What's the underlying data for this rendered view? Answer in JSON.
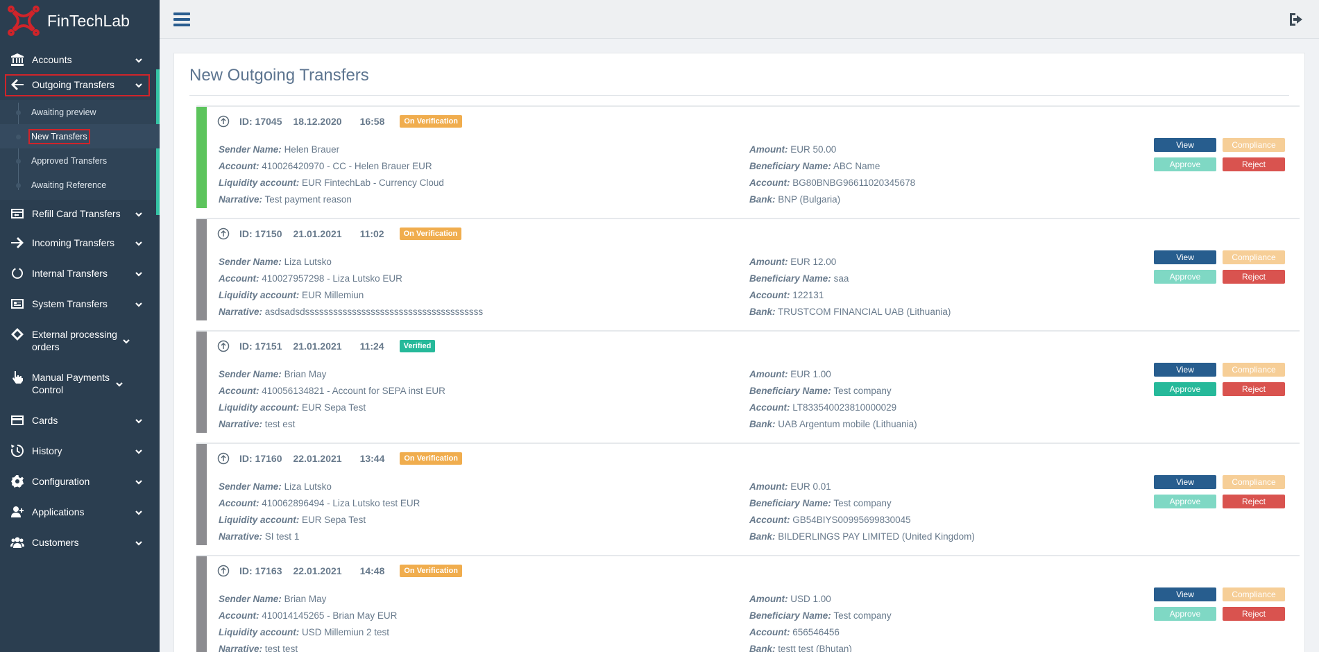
{
  "brand": {
    "name": "FinTechLab",
    "logo_color": "#d0242a"
  },
  "sidebar": {
    "items": [
      {
        "label": "Accounts",
        "icon": "bank-icon"
      },
      {
        "label": "Outgoing Transfers",
        "icon": "arrow-left-icon"
      },
      {
        "label": "Refill Card Transfers",
        "icon": "card-refill-icon"
      },
      {
        "label": "Incoming Transfers",
        "icon": "arrow-right-icon"
      },
      {
        "label": "Internal Transfers",
        "icon": "circle-notch-icon"
      },
      {
        "label": "System Transfers",
        "icon": "id-card-icon"
      },
      {
        "label": "External processing orders",
        "icon": "ticket-icon"
      },
      {
        "label": "Manual Payments Control",
        "icon": "hand-pointer-icon"
      },
      {
        "label": "Cards",
        "icon": "credit-card-icon"
      },
      {
        "label": "History",
        "icon": "history-icon"
      },
      {
        "label": "Configuration",
        "icon": "gear-icon"
      },
      {
        "label": "Applications",
        "icon": "user-plus-icon"
      },
      {
        "label": "Customers",
        "icon": "users-icon"
      }
    ],
    "submenu": [
      {
        "label": "Awaiting preview"
      },
      {
        "label": "New Transfers"
      },
      {
        "label": "Approved Transfers"
      },
      {
        "label": "Awaiting Reference"
      }
    ]
  },
  "page": {
    "title": "New Outgoing Transfers"
  },
  "labels": {
    "sender": "Sender Name:",
    "account": "Account:",
    "liquidity": "Liquidity account:",
    "narrative": "Narrative:",
    "amount": "Amount:",
    "beneficiary": "Beneficiary Name:",
    "ben_account": "Account:",
    "bank": "Bank:",
    "view": "View",
    "compliance": "Compliance",
    "approve": "Approve",
    "reject": "Reject"
  },
  "transfers": [
    {
      "id": "ID: 17045",
      "date": "18.12.2020",
      "time": "16:58",
      "status": "On Verification",
      "sender": "Helen Brauer",
      "account": "410026420970 - CC - Helen Brauer EUR",
      "liquidity": "EUR FintechLab - Currency Cloud",
      "narrative": "Test payment reason",
      "amount": "EUR 50.00",
      "beneficiary": "ABC Name",
      "ben_account": "BG80BNBG96611020345678",
      "bank": "BNP (Bulgaria)"
    },
    {
      "id": "ID: 17150",
      "date": "21.01.2021",
      "time": "11:02",
      "status": "On Verification",
      "sender": "Liza Lutsko",
      "account": "410027957298 - Liza Lutsko EUR",
      "liquidity": "EUR Millemiun",
      "narrative": "asdsadsdssssssssssssssssssssssssssssssssssssss",
      "amount": "EUR 12.00",
      "beneficiary": "saa",
      "ben_account": "122131",
      "bank": "TRUSTCOM FINANCIAL UAB (Lithuania)"
    },
    {
      "id": "ID: 17151",
      "date": "21.01.2021",
      "time": "11:24",
      "status": "Verified",
      "sender": "Brian May",
      "account": "410056134821 - Account for SEPA inst EUR",
      "liquidity": "EUR Sepa Test",
      "narrative": "test est",
      "amount": "EUR 1.00",
      "beneficiary": "Test company",
      "ben_account": "LT833540023810000029",
      "bank": "UAB Argentum mobile (Lithuania)"
    },
    {
      "id": "ID: 17160",
      "date": "22.01.2021",
      "time": "13:44",
      "status": "On Verification",
      "sender": "Liza Lutsko",
      "account": "410062896494 - Liza Lutsko test EUR",
      "liquidity": "EUR Sepa Test",
      "narrative": "SI test 1",
      "amount": "EUR 0.01",
      "beneficiary": "Test company",
      "ben_account": "GB54BIYS00995699830045",
      "bank": "BILDERLINGS PAY LIMITED (United Kingdom)"
    },
    {
      "id": "ID: 17163",
      "date": "22.01.2021",
      "time": "14:48",
      "status": "On Verification",
      "sender": "Brian May",
      "account": "410014145265 - Brian May EUR",
      "liquidity": "USD Millemiun 2 test",
      "narrative": "test test",
      "amount": "USD 1.00",
      "beneficiary": "Test company",
      "ben_account": "656546456",
      "bank": "testt test (Bhutan)"
    }
  ],
  "colors": {
    "sidebar": "#2b3e50",
    "accent": "#34c3a4",
    "view": "#275d8e",
    "reject": "#d9534f",
    "badge_orange": "#f0ad4e",
    "badge_green": "#26b99a"
  }
}
